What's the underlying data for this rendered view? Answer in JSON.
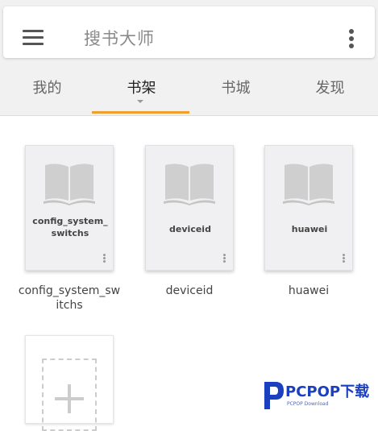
{
  "search": {
    "placeholder": "搜书大师"
  },
  "tabs": [
    {
      "label": "我的",
      "active": false
    },
    {
      "label": "书架",
      "active": true
    },
    {
      "label": "书城",
      "active": false
    },
    {
      "label": "发现",
      "active": false
    }
  ],
  "books": [
    {
      "cover_title": "config_system_switchs",
      "name": "config_system_switchs"
    },
    {
      "cover_title": "deviceid",
      "name": "deviceid"
    },
    {
      "cover_title": "huawei",
      "name": "huawei"
    }
  ],
  "icons": {
    "menu": "hamburger-menu-icon",
    "more": "more-vertical-icon",
    "book": "open-book-icon",
    "add": "plus-icon"
  },
  "colors": {
    "accent": "#f0a030",
    "watermark": "#1a3fbf"
  },
  "watermark": {
    "brand": "PCPOP下载",
    "sub": "PCPOP Download"
  }
}
